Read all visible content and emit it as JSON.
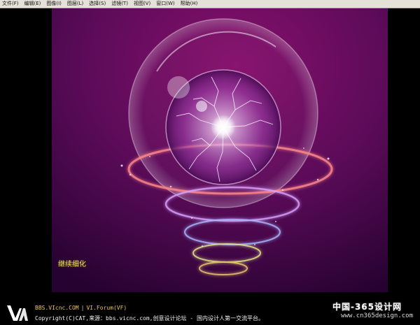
{
  "menubar": {
    "items": [
      "文件(F)",
      "编辑(E)",
      "图像(I)",
      "图层(L)",
      "选择(S)",
      "滤镜(T)",
      "视图(V)",
      "窗口(W)",
      "帮助(H)"
    ]
  },
  "canvas": {
    "caption": "继续细化",
    "colors": {
      "bg_top": "#7a0d63",
      "bg_mid": "#5a0a57",
      "bg_bottom": "#2a0230"
    }
  },
  "footer": {
    "site": "BBS.VIcnc.COM",
    "separator": "|",
    "forum": "VI.Forum(VF)",
    "copyright": "Copyright(C)CAT,来源：bbs.vicnc.com,创意设计论坛 - 国内设计人第一交流平台。"
  },
  "watermark": {
    "line1": "中国-365设计网",
    "line2": "www.cn365design.com"
  }
}
